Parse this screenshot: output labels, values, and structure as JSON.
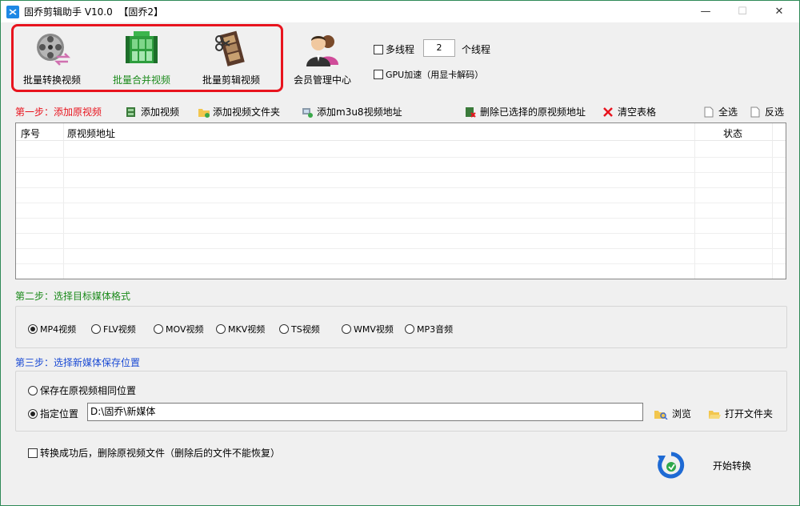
{
  "window": {
    "title": "固乔剪辑助手 V10.0  【固乔2】",
    "controls": {
      "minimize": "—",
      "maximize": "☐",
      "close": "✕"
    }
  },
  "toolbar": {
    "batch_convert": "批量转换视频",
    "batch_merge": "批量合并视频",
    "batch_cut": "批量剪辑视频",
    "member_center": "会员管理中心"
  },
  "options": {
    "multithread": "多线程",
    "thread_count": "2",
    "thread_unit": "个线程",
    "gpu": "GPU加速（用显卡解码）"
  },
  "step1": {
    "label": "第一步：添加原视频",
    "add_video": "添加视频",
    "add_folder": "添加视频文件夹",
    "add_m3u8": "添加m3u8视频地址",
    "delete_selected": "删除已选择的原视频地址",
    "clear_table": "清空表格",
    "select_all": "全选",
    "invert_select": "反选"
  },
  "table": {
    "columns": [
      "序号",
      "原视频地址",
      "状态"
    ],
    "rows": []
  },
  "step2": {
    "label": "第二步：选择目标媒体格式",
    "formats": [
      "MP4视频",
      "FLV视频",
      "MOV视频",
      "MKV视频",
      "TS视频",
      "WMV视频",
      "MP3音频"
    ],
    "selected": "MP4视频"
  },
  "step3": {
    "label": "第三步：选择新媒体保存位置",
    "same_location": "保存在原视频相同位置",
    "custom_location": "指定位置",
    "path": "D:\\固乔\\新媒体",
    "browse": "浏览",
    "open_folder": "打开文件夹"
  },
  "footer": {
    "delete_after": "转换成功后，删除原视频文件（删除后的文件不能恢复）",
    "start": "开始转换"
  },
  "colors": {
    "accent_red": "#e8141e",
    "step2_green": "#1b8a1b",
    "step3_blue": "#1a4ad4"
  }
}
